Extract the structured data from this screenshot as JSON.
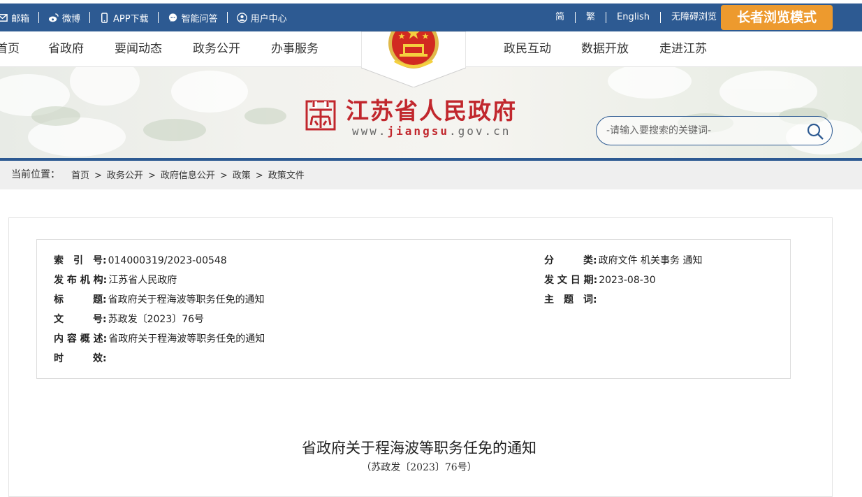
{
  "topbar": {
    "left_links": [
      {
        "label": "邮箱",
        "icon": "mail-icon"
      },
      {
        "label": "微博",
        "icon": "weibo-icon"
      },
      {
        "label": "APP下载",
        "icon": "phone-icon"
      },
      {
        "label": "智能问答",
        "icon": "chat-icon"
      },
      {
        "label": "用户中心",
        "icon": "user-icon"
      }
    ],
    "right_links": [
      "简",
      "繁",
      "English",
      "无障碍浏览"
    ],
    "elder_mode_label": "长者浏览模式"
  },
  "nav": {
    "left_items": [
      "首页",
      "省政府",
      "要闻动态",
      "政务公开",
      "办事服务"
    ],
    "right_items": [
      "政民互动",
      "数据开放",
      "走进江苏"
    ]
  },
  "banner": {
    "site_name": "江苏省人民政府",
    "url_prefix": "www.",
    "url_domain": "jiangsu",
    "url_suffix": ".gov.cn",
    "search_placeholder": "-请输入要搜索的关键词-"
  },
  "breadcrumb": {
    "label": "当前位置：",
    "items": [
      "首页",
      "政务公开",
      "政府信息公开",
      "政策",
      "政策文件"
    ],
    "separator": ">"
  },
  "meta": {
    "index_key": "索　引　号:",
    "index_val": "014000319/2023-00548",
    "category_key": "分　　　类:",
    "category_val": "政府文件 机关事务 通知",
    "issuer_key": "发 布 机 构:",
    "issuer_val": "江苏省人民政府",
    "date_key": "发 文 日 期:",
    "date_val": "2023-08-30",
    "title_key": "标　　　题:",
    "title_val": "省政府关于程海波等职务任免的通知",
    "keywords_key": "主　题　词:",
    "keywords_val": "",
    "docno_key": "文　　　号:",
    "docno_val": "苏政发〔2023〕76号",
    "summary_key": "内 容 概 述:",
    "summary_val": "省政府关于程海波等职务任免的通知",
    "validity_key": "时　　　效:",
    "validity_val": ""
  },
  "document": {
    "title": "省政府关于程海波等职务任免的通知",
    "number": "（苏政发〔2023〕76号）"
  },
  "colors": {
    "primary": "#2d5a92",
    "elder_button": "#ed9a2e",
    "brand_red": "#c1272d"
  }
}
